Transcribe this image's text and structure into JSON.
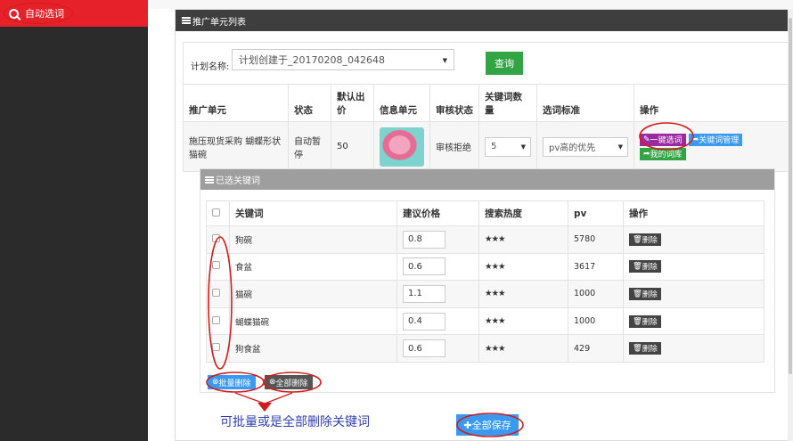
{
  "sidebar": {
    "item_label": "自动选词"
  },
  "panel": {
    "title": "推广单元列表"
  },
  "query": {
    "plan_label": "计划名称:",
    "plan_value": "计划创建于_20170208_042648",
    "query_button": "查询"
  },
  "unit_table": {
    "headers": [
      "推广单元",
      "状态",
      "默认出价",
      "信息单元",
      "审核状态",
      "关键词数量",
      "选词标准",
      "操作"
    ],
    "row": {
      "name": "施压现货采购 蝴蝶形状猫碗",
      "status": "自动暂停",
      "bid": "50",
      "audit": "审核拒绝",
      "kw_count": "5",
      "standard": "pv高的优先",
      "ops": {
        "one_click": "一键选词",
        "kw_manage": "关键词管理",
        "my_lib": "我的词库"
      }
    }
  },
  "keywords": {
    "title": "已选关键词",
    "headers": [
      "关键词",
      "建议价格",
      "搜索热度",
      "pv",
      "操作"
    ],
    "rows": [
      {
        "keyword": "狗碗",
        "price": "0.8",
        "heat": "★★★",
        "pv": "5780",
        "op": "删除"
      },
      {
        "keyword": "食盆",
        "price": "0.6",
        "heat": "★★★",
        "pv": "3617",
        "op": "删除"
      },
      {
        "keyword": "猫碗",
        "price": "1.1",
        "heat": "★★★",
        "pv": "1000",
        "op": "删除"
      },
      {
        "keyword": "蝴蝶猫碗",
        "price": "0.4",
        "heat": "★★★",
        "pv": "1000",
        "op": "删除"
      },
      {
        "keyword": "狗食盆",
        "price": "0.6",
        "heat": "★★★",
        "pv": "429",
        "op": "删除"
      }
    ],
    "batch_delete": "批量删除",
    "delete_all": "全部删除"
  },
  "save_button": "全部保存",
  "annotation_note": "可批量或是全部删除关键词",
  "colors": {
    "accent_red": "#e62129",
    "green": "#33a444",
    "blue": "#3a9af2",
    "purple": "#9b2aa0",
    "note_blue": "#2f3fb0",
    "annotation_red": "#d21c1c"
  }
}
